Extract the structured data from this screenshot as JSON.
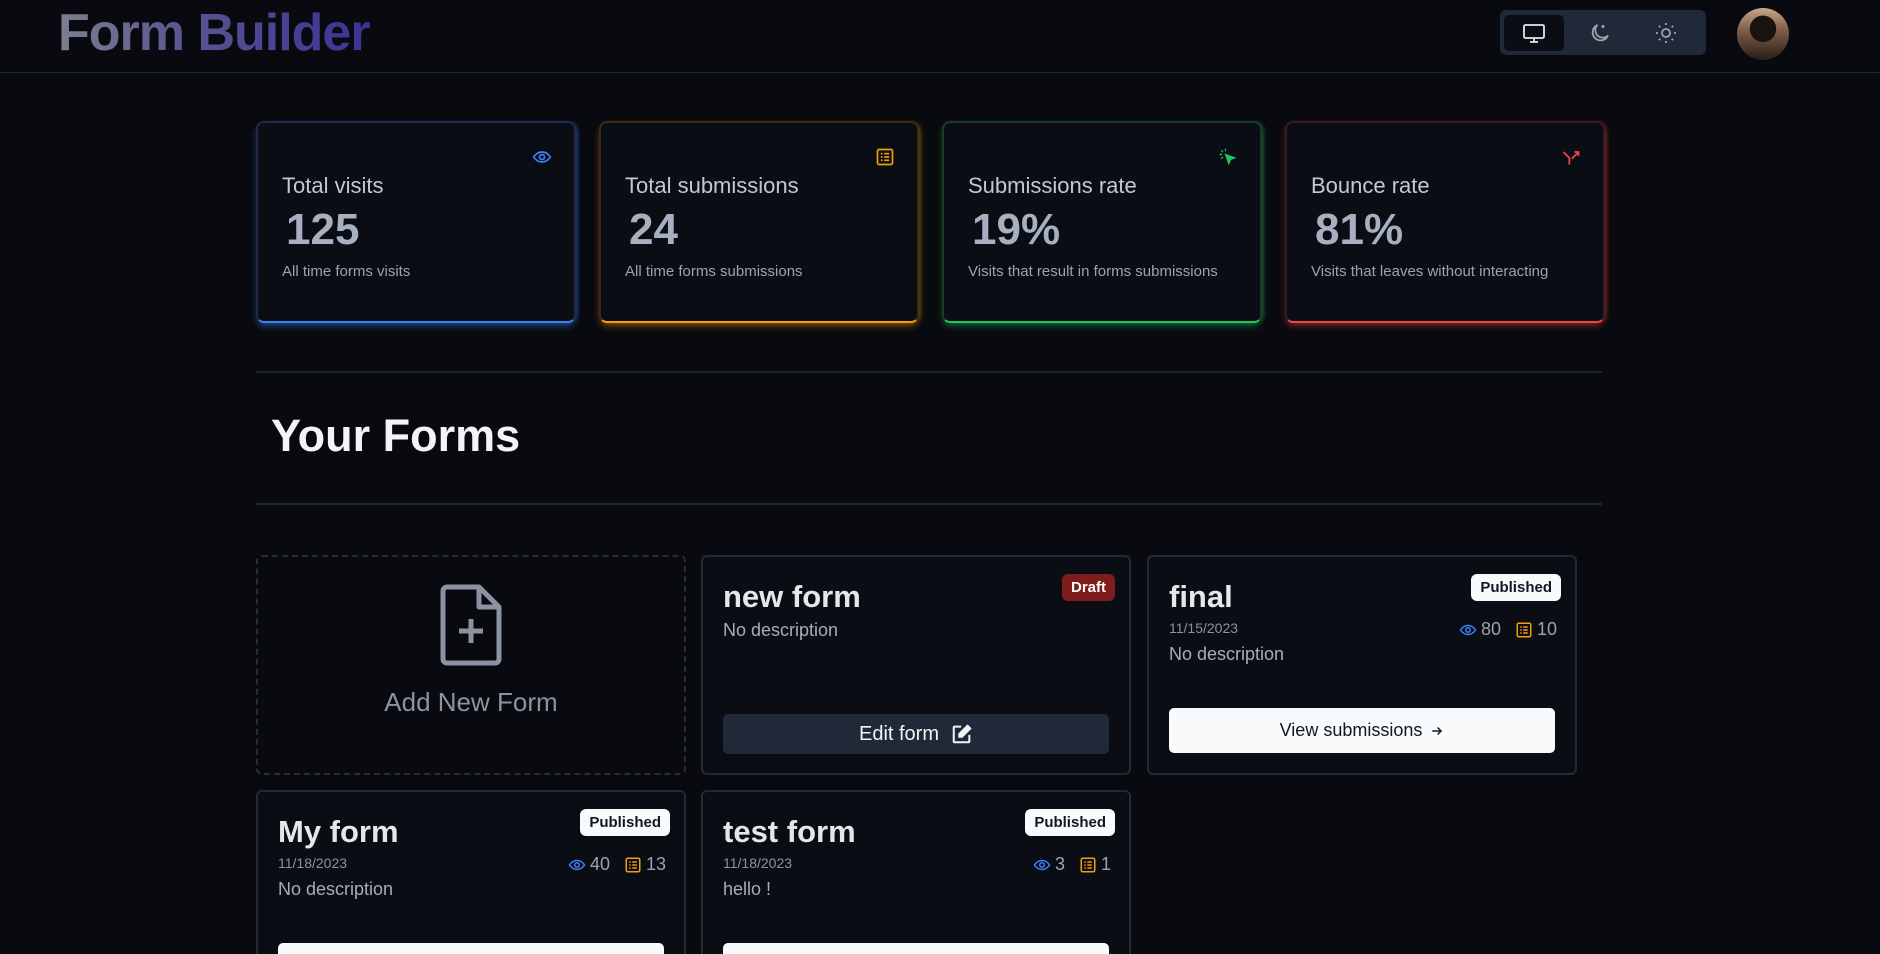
{
  "header": {
    "brand": "Form Builder",
    "theme_options": [
      {
        "name": "system",
        "icon": "monitor-icon",
        "active": true
      },
      {
        "name": "dark",
        "icon": "moon-icon",
        "active": false
      },
      {
        "name": "light",
        "icon": "sun-icon",
        "active": false
      }
    ]
  },
  "stats": [
    {
      "title": "Total visits",
      "value": "125",
      "helper": "All time forms visits",
      "icon": "eye-icon",
      "color": "#3b82f6"
    },
    {
      "title": "Total submissions",
      "value": "24",
      "helper": "All time forms submissions",
      "icon": "form-list-icon",
      "color": "#f59e0b"
    },
    {
      "title": "Submissions rate",
      "value": "19%",
      "helper": "Visits that result in forms submissions",
      "icon": "cursor-click-icon",
      "color": "#22c55e"
    },
    {
      "title": "Bounce rate",
      "value": "81%",
      "helper": "Visits that leaves without interacting",
      "icon": "split-arrow-icon",
      "color": "#ef4444"
    }
  ],
  "section": {
    "title": "Your Forms"
  },
  "add_card": {
    "label": "Add New Form",
    "icon": "file-plus-icon"
  },
  "forms": [
    {
      "title": "new form",
      "status": "Draft",
      "description": "No description",
      "action": "Edit form",
      "action_icon": "edit-icon"
    },
    {
      "title": "final",
      "status": "Published",
      "date": "11/15/2023",
      "visits": "80",
      "submissions": "10",
      "description": "No description",
      "action": "View submissions",
      "action_icon": "arrow-right-icon"
    },
    {
      "title": "My form",
      "status": "Published",
      "date": "11/18/2023",
      "visits": "40",
      "submissions": "13",
      "description": "No description"
    },
    {
      "title": "test form",
      "status": "Published",
      "date": "11/18/2023",
      "visits": "3",
      "submissions": "1",
      "description": "hello !"
    }
  ]
}
